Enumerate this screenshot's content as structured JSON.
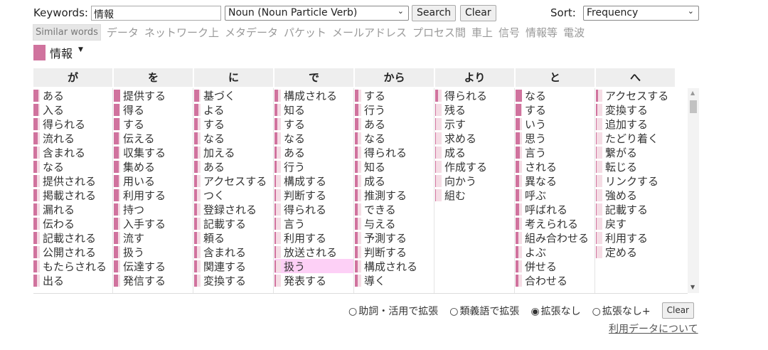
{
  "search": {
    "keywords_label": "Keywords:",
    "keyword_value": "情報",
    "pos_selected": "Noun (Noun Particle Verb)",
    "search_label": "Search",
    "clear_label": "Clear",
    "sort_label": "Sort:",
    "sort_selected": "Frequency"
  },
  "similar": {
    "label": "Similar words",
    "words": [
      "データ",
      "ネットワーク上",
      "メタデータ",
      "パケット",
      "メールアドレス",
      "プロセス間",
      "車上",
      "信号",
      "情報等",
      "電波"
    ]
  },
  "legend": {
    "term": "情報",
    "color": "#d0739e"
  },
  "columns": [
    {
      "header": "が",
      "items": [
        "ある",
        "入る",
        "得られる",
        "流れる",
        "含まれる",
        "なる",
        "提供される",
        "掲載される",
        "漏れる",
        "伝わる",
        "記載される",
        "公開される",
        "もたらされる",
        "出る"
      ],
      "strength": [
        0.8,
        0.8,
        0.7,
        0.7,
        0.6,
        0.6,
        0.6,
        0.6,
        0.6,
        0.6,
        0.6,
        0.6,
        0.6,
        0.6
      ]
    },
    {
      "header": "を",
      "items": [
        "提供する",
        "得る",
        "する",
        "伝える",
        "収集する",
        "集める",
        "用いる",
        "利用する",
        "持つ",
        "入手する",
        "流す",
        "扱う",
        "伝達する",
        "発信する"
      ],
      "strength": [
        1,
        0.9,
        0.9,
        0.8,
        0.8,
        0.8,
        0.8,
        0.8,
        0.7,
        0.7,
        0.7,
        0.7,
        0.7,
        0.7
      ]
    },
    {
      "header": "に",
      "items": [
        "基づく",
        "よる",
        "する",
        "なる",
        "加える",
        "ある",
        "アクセスする",
        "つく",
        "登録される",
        "記載する",
        "頼る",
        "含まれる",
        "関連する",
        "変換する"
      ],
      "strength": [
        0.8,
        0.7,
        0.6,
        0.5,
        0.5,
        0.5,
        0.4,
        0.4,
        0.4,
        0.4,
        0.4,
        0.4,
        0.4,
        0.4
      ]
    },
    {
      "header": "で",
      "items": [
        "構成される",
        "知る",
        "する",
        "なる",
        "ある",
        "行う",
        "構成する",
        "判断する",
        "得られる",
        "言う",
        "利用する",
        "放送される",
        "扱う",
        "発表する"
      ],
      "strength": [
        0.5,
        0.4,
        0.4,
        0.4,
        0.3,
        0.3,
        0.2,
        0.2,
        0.2,
        0.2,
        0.2,
        0.2,
        0.2,
        0.2
      ]
    },
    {
      "header": "から",
      "items": [
        "する",
        "行う",
        "ある",
        "なる",
        "得られる",
        "知る",
        "成る",
        "推測する",
        "できる",
        "与える",
        "予測する",
        "判断する",
        "構成される",
        "導く"
      ],
      "strength": [
        0.5,
        0.5,
        0.5,
        0.4,
        0.4,
        0.4,
        0.4,
        0.4,
        0.4,
        0.4,
        0.4,
        0.4,
        0.4,
        0.4
      ]
    },
    {
      "header": "より",
      "items": [
        "得られる",
        "残る",
        "示す",
        "求める",
        "成る",
        "作成する",
        "向かう",
        "組む"
      ],
      "strength": [
        0.4,
        0.1,
        0.1,
        0.1,
        0.1,
        0.1,
        0.1,
        0.1
      ]
    },
    {
      "header": "と",
      "items": [
        "なる",
        "する",
        "いう",
        "思う",
        "言う",
        "される",
        "異なる",
        "呼ぶ",
        "呼ばれる",
        "考えられる",
        "組み合わせる",
        "よぶ",
        "併せる",
        "合わせる"
      ],
      "strength": [
        1,
        0.9,
        0.7,
        0.7,
        0.7,
        0.6,
        0.6,
        0.5,
        0.5,
        0.5,
        0.4,
        0.4,
        0.4,
        0.4
      ]
    },
    {
      "header": "へ",
      "items": [
        "アクセスする",
        "変換する",
        "追加する",
        "たどり着く",
        "繋がる",
        "転じる",
        "リンクする",
        "強める",
        "記載する",
        "戻す",
        "利用する",
        "定める"
      ],
      "strength": [
        0.3,
        0.2,
        0.05,
        0.05,
        0.05,
        0.05,
        0.05,
        0.05,
        0.05,
        0.05,
        0.05,
        0.05
      ]
    }
  ],
  "highlight": {
    "column": 3,
    "item": "扱う"
  },
  "expansion": {
    "options": [
      "助詞・活用で拡張",
      "類義語で拡張",
      "拡張なし",
      "拡張なし+"
    ],
    "selected": "拡張なし",
    "clear_label": "Clear"
  },
  "footer_link": "利用データについて"
}
